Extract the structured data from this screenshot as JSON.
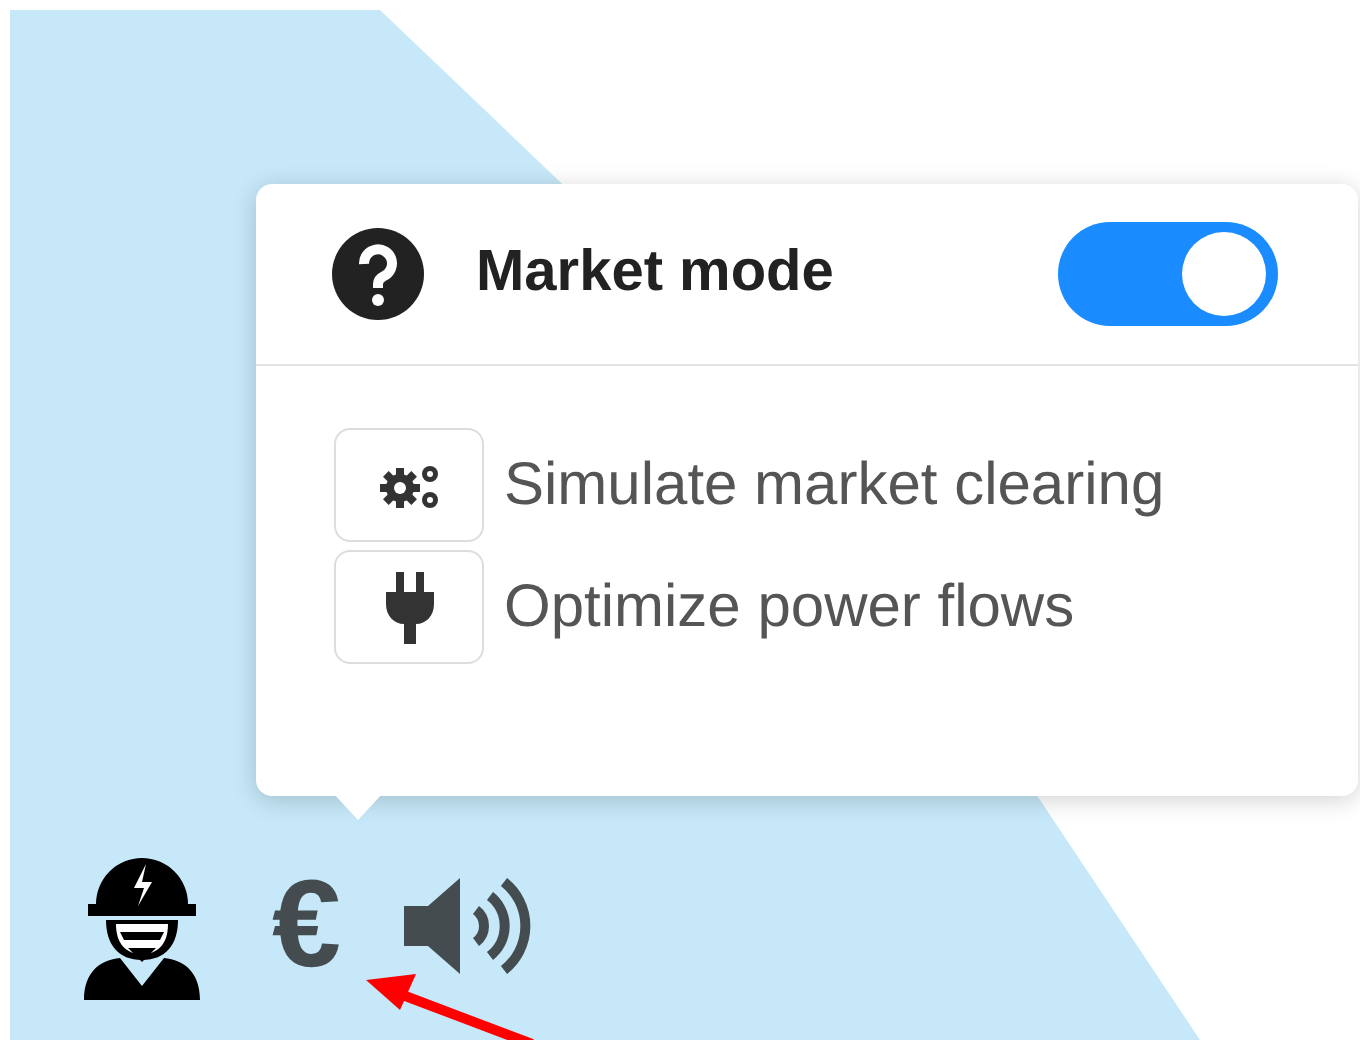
{
  "popover": {
    "title": "Market mode",
    "toggle": {
      "on": true
    },
    "options": [
      {
        "kind": "gears",
        "label": "Simulate market clearing"
      },
      {
        "kind": "plug",
        "label": "Optimize power flows"
      }
    ]
  },
  "toolbar": {
    "currency": "€"
  }
}
